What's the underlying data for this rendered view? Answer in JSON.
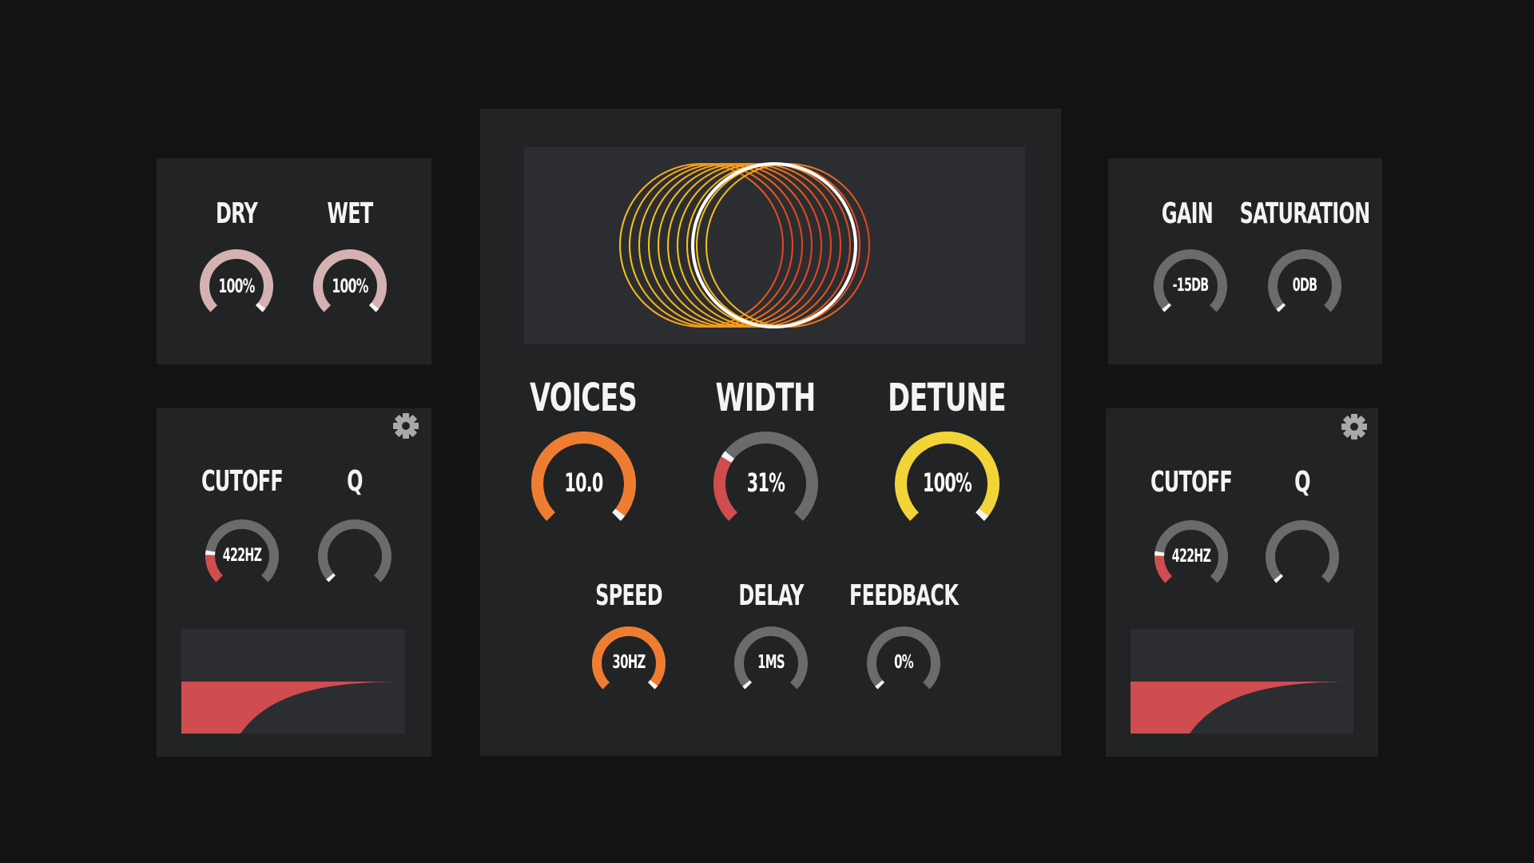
{
  "colors": {
    "background": "#131314",
    "panel": "#222324",
    "display": "#2c2d31",
    "track": "#6a6b6c",
    "pink": "#d6b1b2",
    "orange": "#ef7d31",
    "red": "#cf4d4f",
    "yellow": "#f3d438",
    "marker": "#f5f5f5"
  },
  "mix": {
    "dry": {
      "label": "DRY",
      "value": "100%",
      "level": 1.0
    },
    "wet": {
      "label": "WET",
      "value": "100%",
      "level": 1.0
    }
  },
  "drive": {
    "gain": {
      "label": "GAIN",
      "value": "-15DB",
      "level": 0.0
    },
    "saturation": {
      "label": "SATURATION",
      "value": "0DB",
      "level": 0.0
    }
  },
  "chorus": {
    "voices": {
      "label": "VOICES",
      "value": "10.0",
      "level": 1.0
    },
    "width": {
      "label": "WIDTH",
      "value": "31%",
      "level": 0.31
    },
    "detune": {
      "label": "DETUNE",
      "value": "100%",
      "level": 1.0
    },
    "speed": {
      "label": "SPEED",
      "value": "30HZ",
      "level": 1.0
    },
    "delay": {
      "label": "DELAY",
      "value": "1MS",
      "level": 0.0
    },
    "feedback": {
      "label": "FEEDBACK",
      "value": "0%",
      "level": 0.0
    }
  },
  "filter_left": {
    "cutoff": {
      "label": "CUTOFF",
      "value": "422HZ",
      "level": 0.2
    },
    "q": {
      "label": "Q",
      "value": "",
      "level": 0.0
    },
    "settings_icon": "gear-icon"
  },
  "filter_right": {
    "cutoff": {
      "label": "CUTOFF",
      "value": "422HZ",
      "level": 0.2
    },
    "q": {
      "label": "Q",
      "value": "",
      "level": 0.0
    },
    "settings_icon": "gear-icon"
  }
}
